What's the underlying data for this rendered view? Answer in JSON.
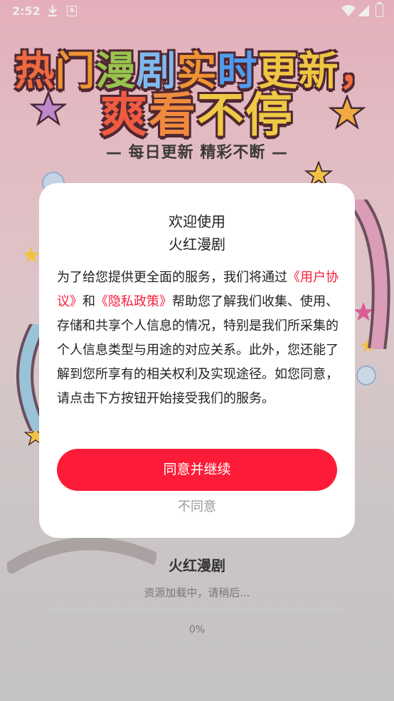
{
  "status_bar": {
    "time": "2:52",
    "icons": [
      "download-icon",
      "a-notification-icon",
      "wifi-icon",
      "signal-icon",
      "battery-icon"
    ]
  },
  "banner": {
    "headline_line1": [
      "热",
      "门",
      "漫",
      "剧",
      "实",
      "时",
      "更新",
      "，"
    ],
    "headline_line2": [
      "爽",
      "看",
      "不",
      "停"
    ],
    "subline": "— 每日更新 精彩不断 —"
  },
  "dialog": {
    "title_line1": "欢迎使用",
    "title_line2": "火红漫剧",
    "body_part1": "为了给您提供更全面的服务，我们将通过",
    "link_user_agreement": "《用户协议》",
    "body_and": "和",
    "link_privacy_policy": "《隐私政策》",
    "body_part2": "帮助您了解我们收集、使用、存储和共享个人信息的情况，特别是我们所采集的个人信息类型与用途的对应关系。此外，您还能了解到您所享有的相关权利及实现途径。如您同意，请点击下方按钮开始接受我们的服务。",
    "agree_label": "同意并继续",
    "disagree_label": "不同意"
  },
  "loading": {
    "app_name": "火红漫剧",
    "message": "资源加载中，请稍后...",
    "progress": 0,
    "progress_label": "0%"
  },
  "colors": {
    "accent": "#fd1c37",
    "link": "#f51e3a"
  }
}
